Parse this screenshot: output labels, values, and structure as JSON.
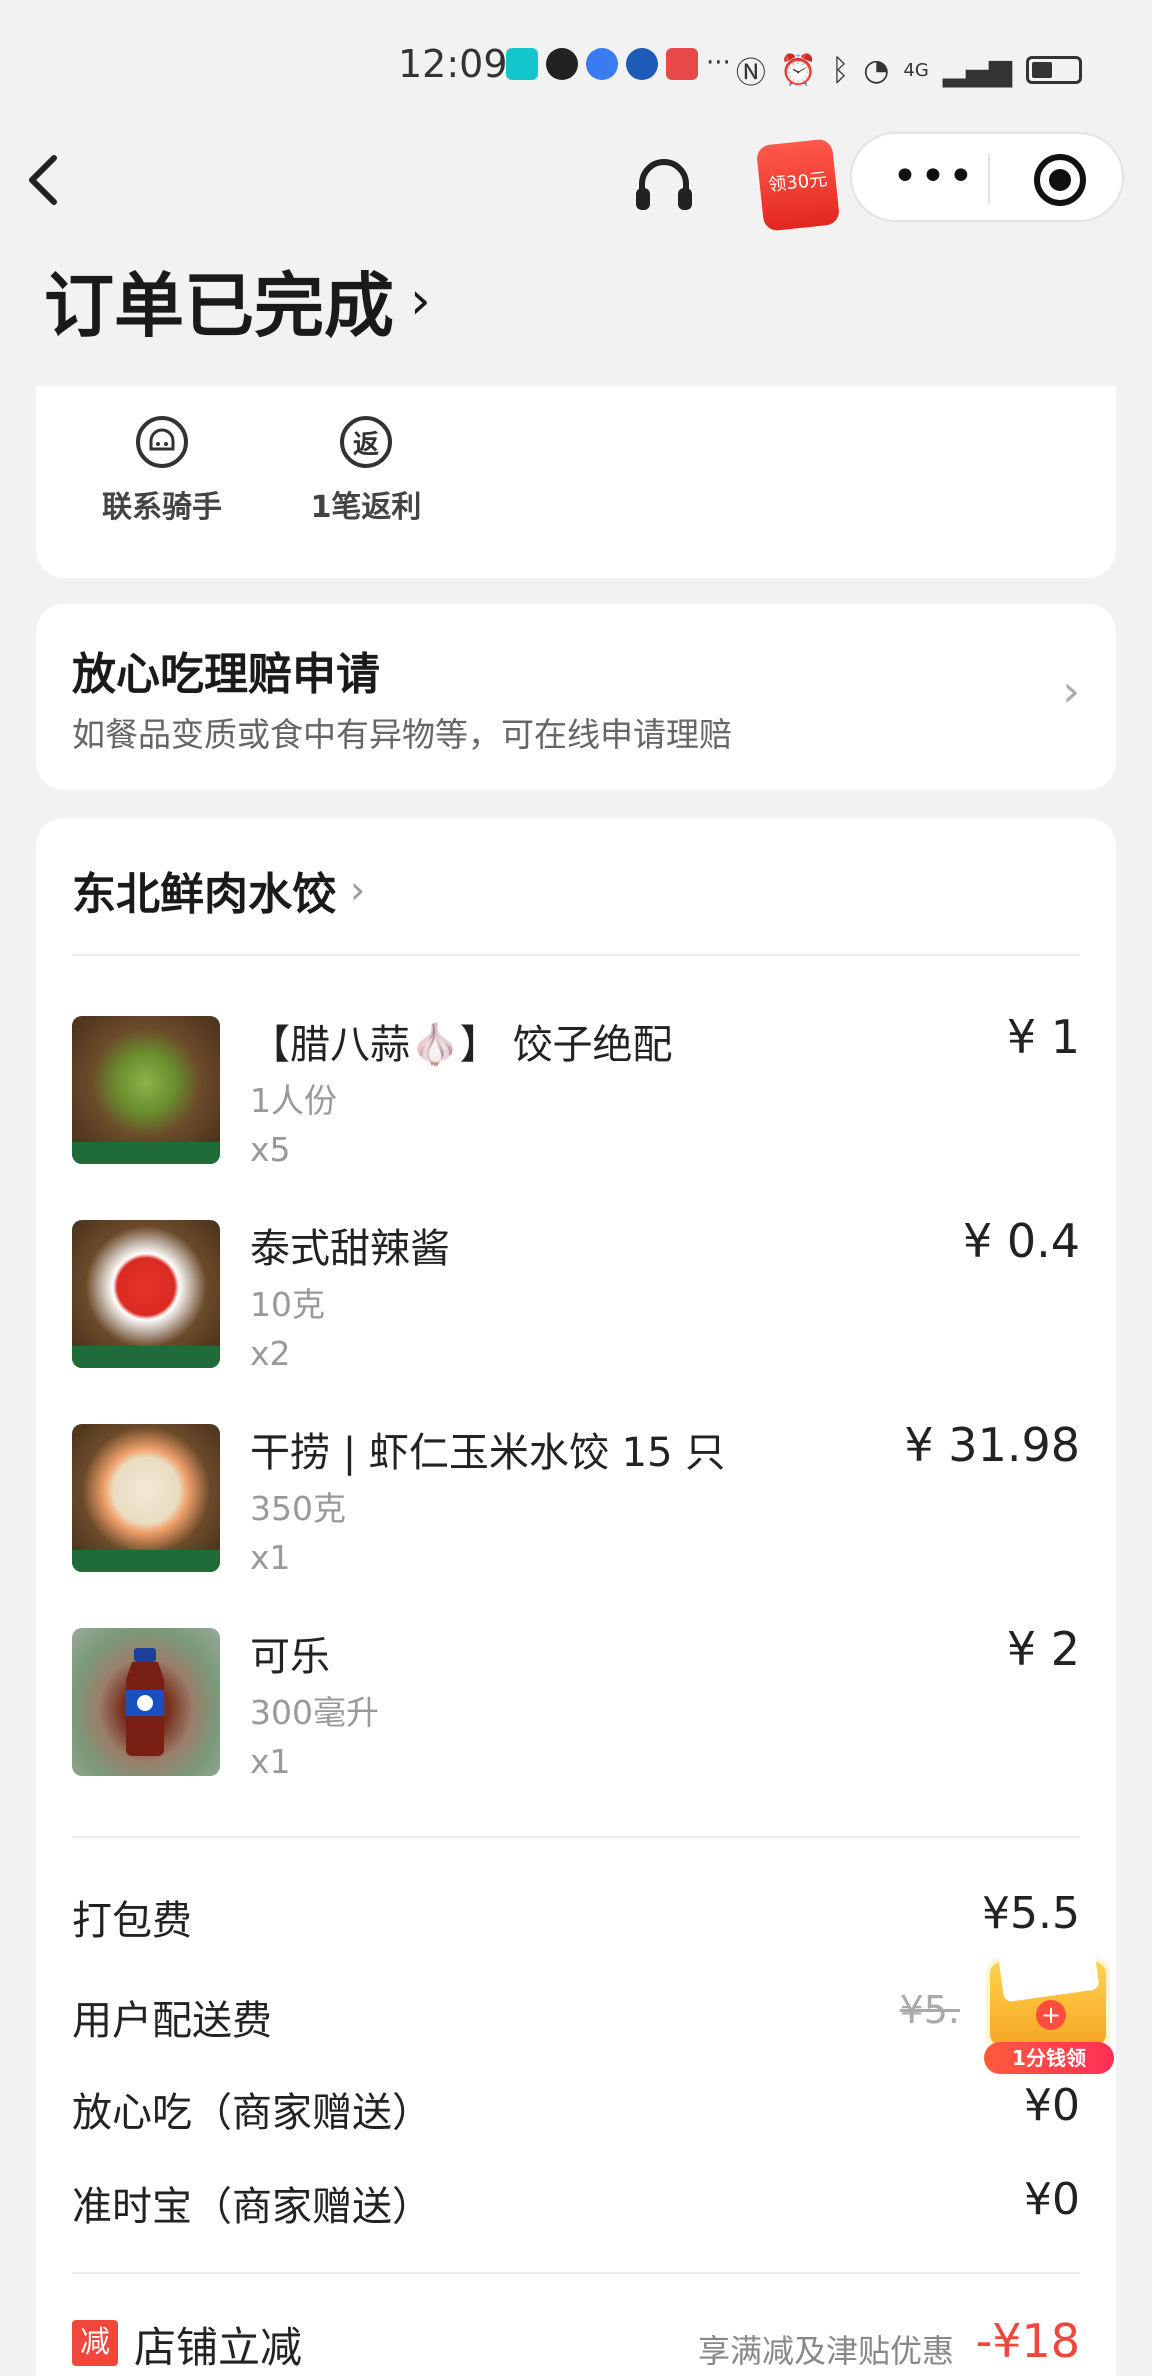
{
  "status_bar": {
    "time": "12:09",
    "more": "···",
    "network": "4G"
  },
  "nav": {
    "back_icon": "chevron-left-icon",
    "service_icon": "headset-icon",
    "coupon_text": "领30元",
    "more_icon": "more-dots-icon",
    "close_icon": "target-icon"
  },
  "order": {
    "status": "订单已完成"
  },
  "actions": [
    {
      "label": "联系骑手",
      "icon": "rider-helmet-icon"
    },
    {
      "label": "1笔返利",
      "icon": "rebate-icon",
      "icon_text": "返"
    }
  ],
  "claim": {
    "title": "放心吃理赔申请",
    "subtitle": "如餐品变质或食中有异物等，可在线申请理赔"
  },
  "shop": {
    "name": "东北鲜肉水饺"
  },
  "items": [
    {
      "name": "【腊八蒜🧄】 饺子绝配",
      "spec": "1人份",
      "qty": "x5",
      "price": "¥ 1"
    },
    {
      "name": "泰式甜辣酱",
      "spec": "10克",
      "qty": "x2",
      "price": "¥ 0.4"
    },
    {
      "name": "干捞 | 虾仁玉米水饺 15 只",
      "spec": "350克",
      "qty": "x1",
      "price": "¥ 31.98"
    },
    {
      "name": "可乐",
      "spec": "300毫升",
      "qty": "x1",
      "price": "¥ 2"
    }
  ],
  "fees": [
    {
      "label": "打包费",
      "value": "¥5.5"
    },
    {
      "label": "用户配送费",
      "value": "¥5."
    },
    {
      "label": "放心吃（商家赠送）",
      "value": "¥0"
    },
    {
      "label": "准时宝（商家赠送）",
      "value": "¥0"
    }
  ],
  "discount": {
    "badge": "减",
    "label": "店铺立减",
    "note": "享满减及津贴优惠",
    "value": "-¥18"
  },
  "floating": {
    "label": "1分钱领"
  },
  "colors": {
    "accent_red": "#f0463c",
    "background": "#f2f2f2",
    "card": "#ffffff"
  }
}
